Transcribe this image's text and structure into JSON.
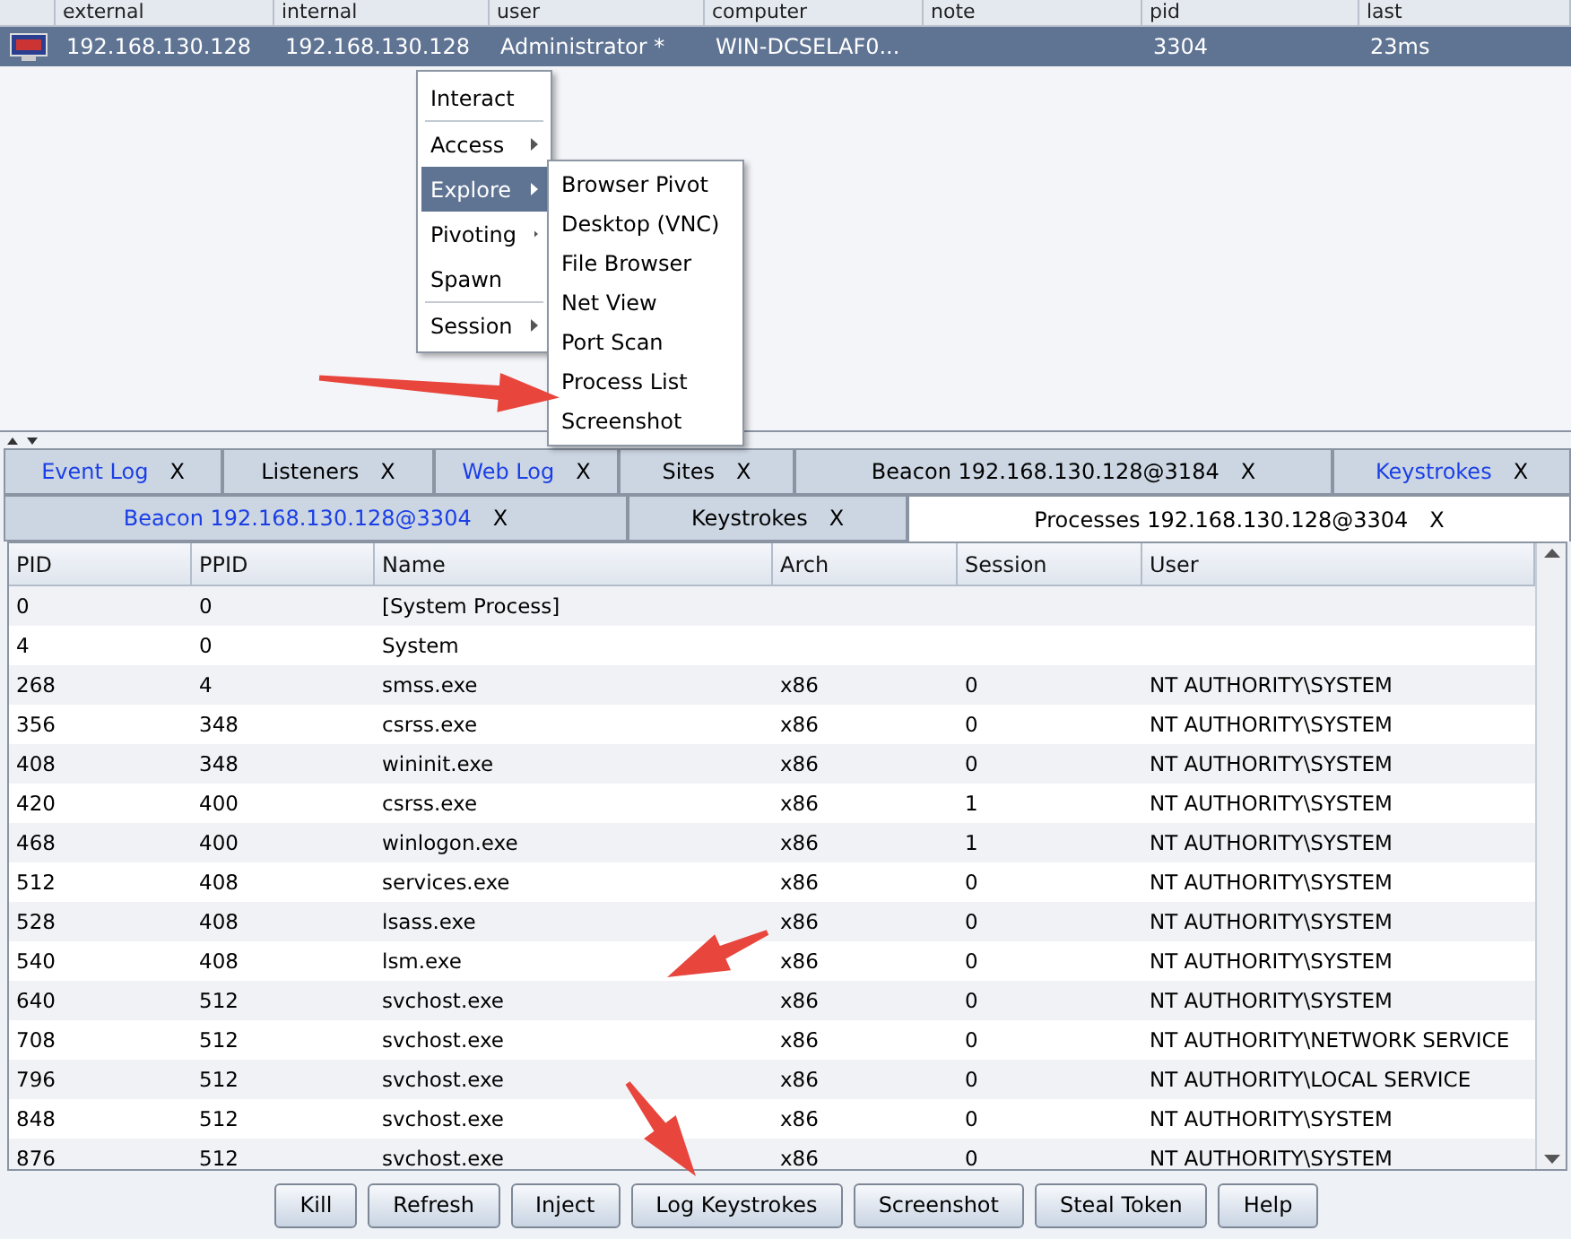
{
  "sessions": {
    "columns": [
      "external",
      "internal",
      "user",
      "computer",
      "note",
      "pid",
      "last"
    ],
    "rows": [
      {
        "selected": true,
        "cells": [
          "192.168.130.128",
          "192.168.130.128",
          "Administrator *",
          "WIN-DCSELAF0...",
          "",
          "3304",
          "23ms"
        ]
      }
    ]
  },
  "context_menu": {
    "items": [
      {
        "kind": "item",
        "label": "Interact",
        "submenu": false,
        "selected": false
      },
      {
        "kind": "separator"
      },
      {
        "kind": "item",
        "label": "Access",
        "submenu": true,
        "selected": false
      },
      {
        "kind": "item",
        "label": "Explore",
        "submenu": true,
        "selected": true
      },
      {
        "kind": "item",
        "label": "Pivoting",
        "submenu": true,
        "selected": false
      },
      {
        "kind": "item",
        "label": "Spawn",
        "submenu": false,
        "selected": false
      },
      {
        "kind": "separator"
      },
      {
        "kind": "item",
        "label": "Session",
        "submenu": true,
        "selected": false
      }
    ],
    "submenu": [
      "Browser Pivot",
      "Desktop (VNC)",
      "File Browser",
      "Net View",
      "Port Scan",
      "Process List",
      "Screenshot"
    ]
  },
  "tabs_row_1": [
    {
      "label": "Event Log",
      "close": "X",
      "color": "#1a3ee6"
    },
    {
      "label": "Listeners",
      "close": "X",
      "color": "#000000"
    },
    {
      "label": "Web Log",
      "close": "X",
      "color": "#1a3ee6"
    },
    {
      "label": "Sites",
      "close": "X",
      "color": "#000000"
    },
    {
      "label": "Beacon 192.168.130.128@3184",
      "close": "X",
      "color": "#000000"
    },
    {
      "label": "Keystrokes",
      "close": "X",
      "color": "#1a3ee6"
    }
  ],
  "tabs_row_2": [
    {
      "label": "Beacon 192.168.130.128@3304",
      "close": "X",
      "color": "#1a3ee6",
      "selected": false
    },
    {
      "label": "Keystrokes",
      "close": "X",
      "color": "#000000",
      "selected": false
    },
    {
      "label": "Processes 192.168.130.128@3304",
      "close": "X",
      "color": "#000000",
      "selected": true
    }
  ],
  "processes": {
    "columns": [
      "PID",
      "PPID",
      "Name",
      "Arch",
      "Session",
      "User"
    ],
    "rows": [
      [
        "0",
        "0",
        "[System Process]",
        "",
        "",
        ""
      ],
      [
        "4",
        "0",
        "System",
        "",
        "",
        ""
      ],
      [
        "268",
        "4",
        "smss.exe",
        "x86",
        "0",
        "NT AUTHORITY\\SYSTEM"
      ],
      [
        "356",
        "348",
        "csrss.exe",
        "x86",
        "0",
        "NT AUTHORITY\\SYSTEM"
      ],
      [
        "408",
        "348",
        "wininit.exe",
        "x86",
        "0",
        "NT AUTHORITY\\SYSTEM"
      ],
      [
        "420",
        "400",
        "csrss.exe",
        "x86",
        "1",
        "NT AUTHORITY\\SYSTEM"
      ],
      [
        "468",
        "400",
        "winlogon.exe",
        "x86",
        "1",
        "NT AUTHORITY\\SYSTEM"
      ],
      [
        "512",
        "408",
        "services.exe",
        "x86",
        "0",
        "NT AUTHORITY\\SYSTEM"
      ],
      [
        "528",
        "408",
        "lsass.exe",
        "x86",
        "0",
        "NT AUTHORITY\\SYSTEM"
      ],
      [
        "540",
        "408",
        "lsm.exe",
        "x86",
        "0",
        "NT AUTHORITY\\SYSTEM"
      ],
      [
        "640",
        "512",
        "svchost.exe",
        "x86",
        "0",
        "NT AUTHORITY\\SYSTEM"
      ],
      [
        "708",
        "512",
        "svchost.exe",
        "x86",
        "0",
        "NT AUTHORITY\\NETWORK SERVICE"
      ],
      [
        "796",
        "512",
        "svchost.exe",
        "x86",
        "0",
        "NT AUTHORITY\\LOCAL SERVICE"
      ],
      [
        "848",
        "512",
        "svchost.exe",
        "x86",
        "0",
        "NT AUTHORITY\\SYSTEM"
      ],
      [
        "876",
        "512",
        "svchost.exe",
        "x86",
        "0",
        "NT AUTHORITY\\SYSTEM"
      ]
    ]
  },
  "buttons": [
    "Kill",
    "Refresh",
    "Inject",
    "Log Keystrokes",
    "Screenshot",
    "Steal Token",
    "Help"
  ]
}
